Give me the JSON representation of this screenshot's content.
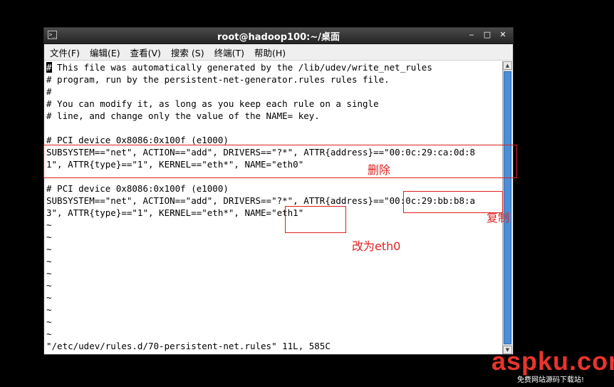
{
  "window": {
    "title": "root@hadoop100:~/桌面",
    "icon_glyph": ">_",
    "controls": {
      "minimize": "‒",
      "maximize": "□",
      "close": "✕"
    }
  },
  "menu": [
    "文件(F)",
    "编辑(E)",
    "查看(V)",
    "搜索 (S)",
    "终端(T)",
    "帮助(H)"
  ],
  "terminal": {
    "cursor_char": "#",
    "lines": [
      " This file was automatically generated by the /lib/udev/write_net_rules",
      "# program, run by the persistent-net-generator.rules rules file.",
      "#",
      "# You can modify it, as long as you keep each rule on a single",
      "# line, and change only the value of the NAME= key.",
      "",
      "# PCI device 0x8086:0x100f (e1000)",
      "SUBSYSTEM==\"net\", ACTION==\"add\", DRIVERS==\"?*\", ATTR{address}==\"00:0c:29:ca:0d:8",
      "1\", ATTR{type}==\"1\", KERNEL==\"eth*\", NAME=\"eth0\"",
      "",
      "# PCI device 0x8086:0x100f (e1000)",
      "SUBSYSTEM==\"net\", ACTION==\"add\", DRIVERS==\"?*\", ATTR{address}==\"00:0c:29:bb:b8:a",
      "3\", ATTR{type}==\"1\", KERNEL==\"eth*\", NAME=\"eth1\"",
      "~",
      "~",
      "~",
      "~",
      "~",
      "~",
      "~",
      "~",
      "~",
      "~",
      "\"/etc/udev/rules.d/70-persistent-net.rules\" 11L, 585C"
    ]
  },
  "annotations": {
    "delete": "删除",
    "copy": "复制",
    "rename": "改为eth0"
  },
  "watermark": {
    "main": "aspku.com",
    "sub": "免费网站源码下载站!"
  },
  "colors": {
    "annotation": "#e02020",
    "scroll_thumb": "#4c8ed8",
    "watermark": "#e8352c"
  }
}
